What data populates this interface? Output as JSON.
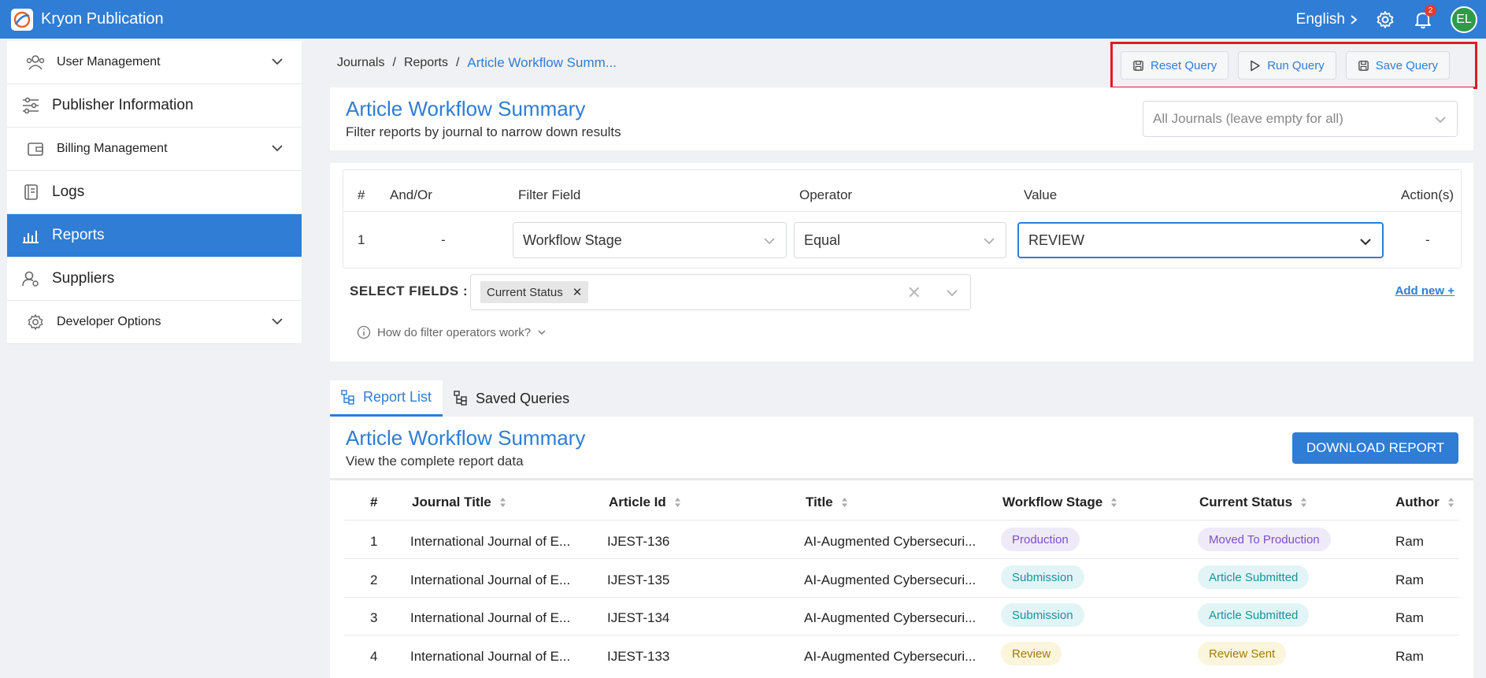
{
  "app": {
    "title": "Kryon Publication",
    "language": "English",
    "notification_count": "2",
    "user_initials": "EL"
  },
  "sidebar": {
    "items": [
      {
        "label": "User Management",
        "icon": "users-icon",
        "expandable": true
      },
      {
        "label": "Publisher Information",
        "icon": "sliders-icon",
        "expandable": false
      },
      {
        "label": "Billing Management",
        "icon": "wallet-icon",
        "expandable": true
      },
      {
        "label": "Logs",
        "icon": "logbook-icon",
        "expandable": false
      },
      {
        "label": "Reports",
        "icon": "bar-chart-icon",
        "expandable": false,
        "active": true
      },
      {
        "label": "Suppliers",
        "icon": "supplier-icon",
        "expandable": false
      },
      {
        "label": "Developer Options",
        "icon": "gear-icon",
        "expandable": true
      }
    ]
  },
  "breadcrumb": {
    "items": [
      "Journals",
      "Reports"
    ],
    "separator": "/",
    "current": "Article Workflow Summ..."
  },
  "toolbar": {
    "reset_label": "Reset Query",
    "run_label": "Run Query",
    "save_label": "Save Query"
  },
  "header": {
    "title": "Article Workflow Summary",
    "subtitle": "Filter reports by journal to narrow down results",
    "journals_placeholder": "All Journals (leave empty for all)"
  },
  "filter": {
    "columns": [
      "#",
      "And/Or",
      "Filter Field",
      "Operator",
      "Value",
      "Action(s)"
    ],
    "rows": [
      {
        "index": "1",
        "andor": "-",
        "field": "Workflow Stage",
        "operator": "Equal",
        "value": "REVIEW",
        "action": "-"
      }
    ],
    "select_fields_label": "SELECT FIELDS :",
    "selected_fields": [
      "Current Status"
    ],
    "add_new_label": "Add new +",
    "help_label": "How do filter operators work?"
  },
  "tabs": [
    {
      "label": "Report List",
      "active": true
    },
    {
      "label": "Saved Queries",
      "active": false
    }
  ],
  "report": {
    "title": "Article Workflow Summary",
    "subtitle": "View the complete report data",
    "download_label": "DOWNLOAD REPORT",
    "columns": [
      "#",
      "Journal Title",
      "Article Id",
      "Title",
      "Workflow Stage",
      "Current Status",
      "Author"
    ],
    "rows": [
      {
        "num": "1",
        "journal": "International Journal of E...",
        "article_id": "IJEST-136",
        "title": "AI-Augmented Cybersecuri...",
        "stage": "Production",
        "status": "Moved To Production",
        "author": "Ram"
      },
      {
        "num": "2",
        "journal": "International Journal of E...",
        "article_id": "IJEST-135",
        "title": "AI-Augmented Cybersecuri...",
        "stage": "Submission",
        "status": "Article Submitted",
        "author": "Ram"
      },
      {
        "num": "3",
        "journal": "International Journal of E...",
        "article_id": "IJEST-134",
        "title": "AI-Augmented Cybersecuri...",
        "stage": "Submission",
        "status": "Article Submitted",
        "author": "Ram"
      },
      {
        "num": "4",
        "journal": "International Journal of E...",
        "article_id": "IJEST-133",
        "title": "AI-Augmented Cybersecuri...",
        "stage": "Review",
        "status": "Review Sent",
        "author": "Ram"
      }
    ]
  },
  "colors": {
    "primary": "#2f7dd4",
    "highlight_border": "#e01b24",
    "avatar": "#2e9b49",
    "badge_purple": "#7c4fc5",
    "badge_teal": "#18929d",
    "badge_yellow": "#a07b09"
  }
}
